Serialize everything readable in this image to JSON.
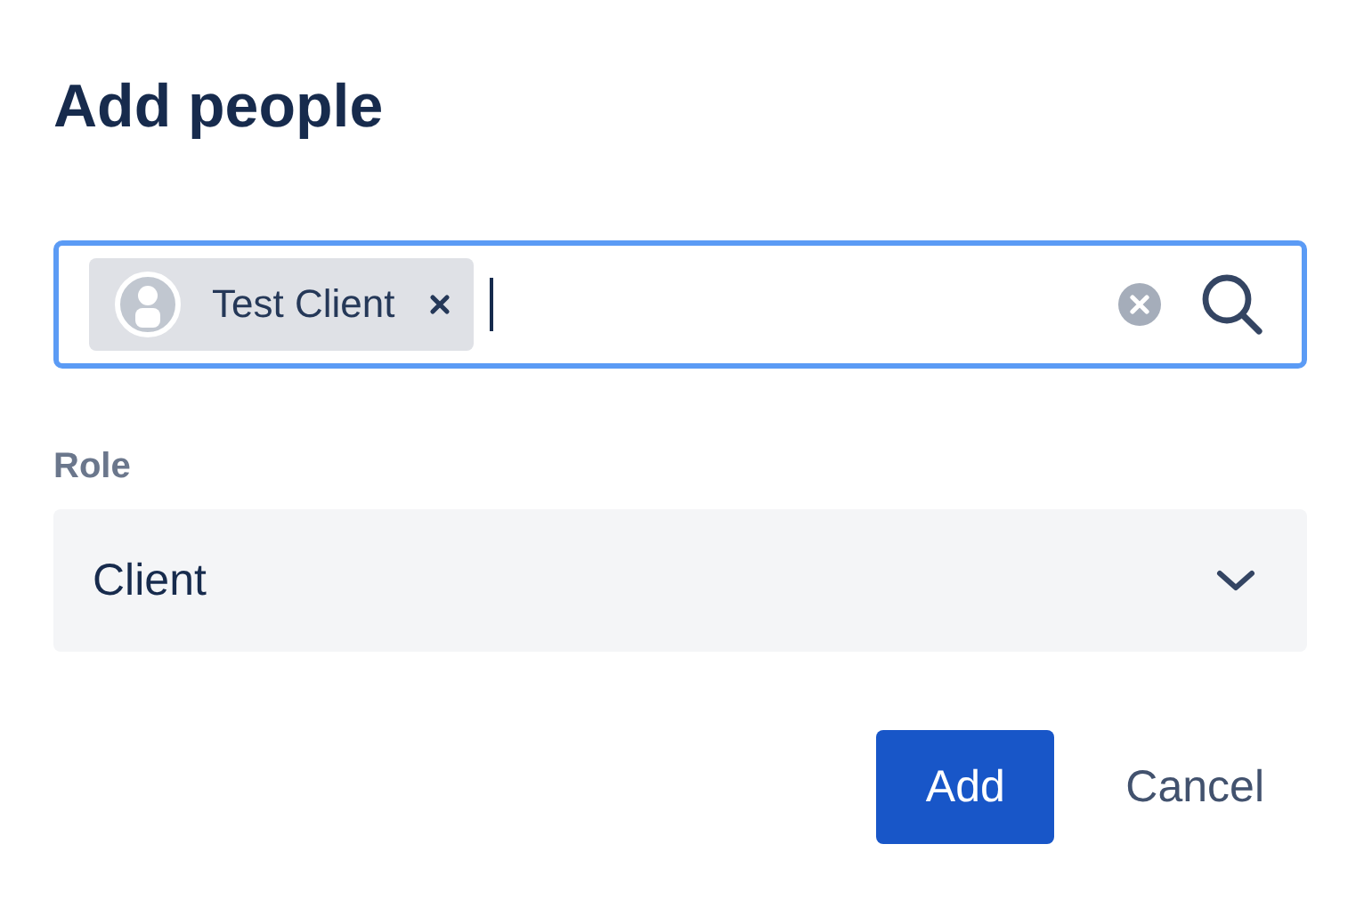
{
  "dialog": {
    "title": "Add people"
  },
  "people_field": {
    "focused": true,
    "chips": [
      {
        "label": "Test Client"
      }
    ]
  },
  "role": {
    "label": "Role",
    "value": "Client"
  },
  "buttons": [
    {
      "label": "Add",
      "kind": "primary"
    },
    {
      "label": "Cancel",
      "kind": "subtle"
    }
  ]
}
